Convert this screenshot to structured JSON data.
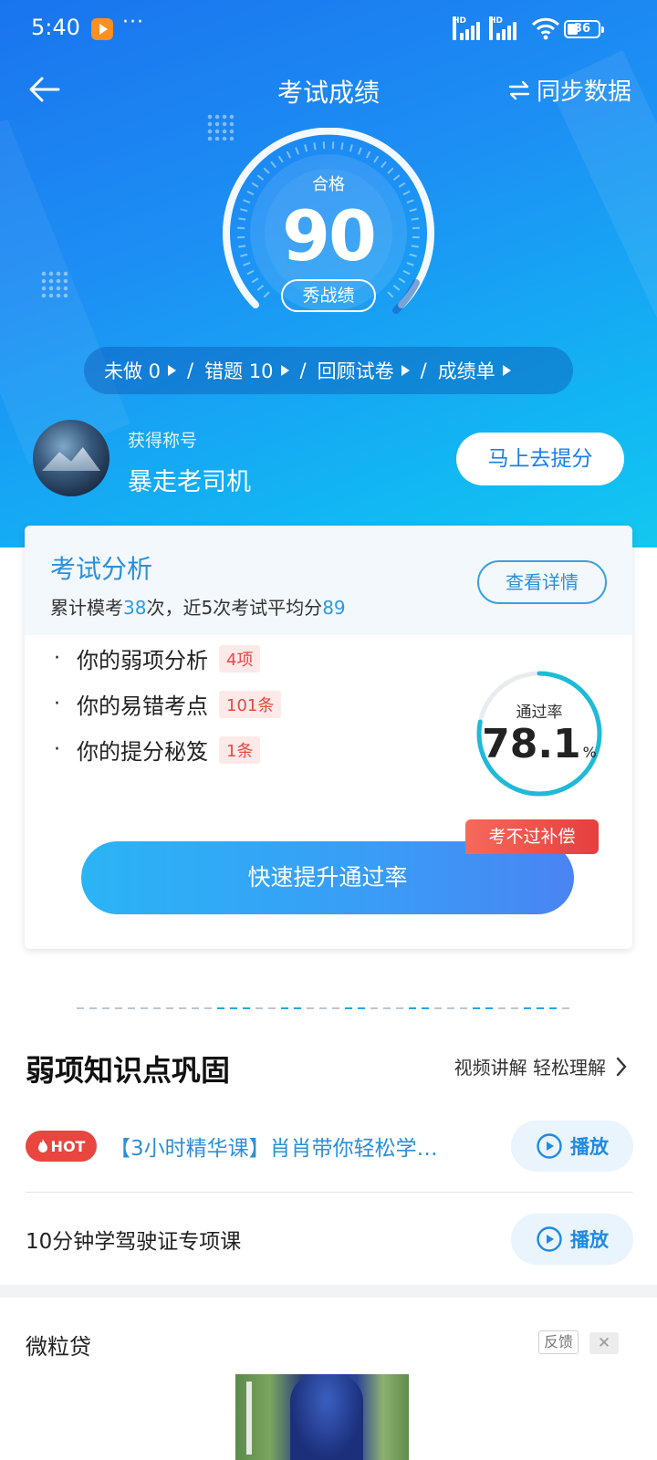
{
  "status_bar": {
    "time": "5:40",
    "more": "···",
    "signal_labels": [
      "HD",
      "HD"
    ],
    "battery": "36"
  },
  "nav": {
    "title": "考试成绩",
    "sync_label": "同步数据"
  },
  "score": {
    "label": "合格",
    "value": "90",
    "show_button": "秀战绩"
  },
  "stats": {
    "undone": "未做 0",
    "wrong": "错题  10",
    "review": "回顾试卷",
    "report": "成绩单",
    "separator": "/"
  },
  "profile": {
    "title_label": "获得称号",
    "nickname": "暴走老司机",
    "improve_button": "马上去提分"
  },
  "analysis": {
    "title": "考试分析",
    "summary_prefix": "累计模考",
    "exam_count": "38",
    "summary_mid": "次，近5次考试平均分",
    "avg_score": "89",
    "detail_button": "查看详情",
    "items": [
      {
        "label": "你的弱项分析",
        "tag": "4项"
      },
      {
        "label": "你的易错考点",
        "tag": "101条"
      },
      {
        "label": "你的提分秘笈",
        "tag": "1条"
      }
    ],
    "pass_rate_label": "通过率",
    "pass_rate": "78.1",
    "pass_rate_unit": "%",
    "pass_rate_fraction": 0.781,
    "compensation_tag": "考不过补偿",
    "boost_button": "快速提升通过率"
  },
  "weak_section": {
    "title": "弱项知识点巩固",
    "subtitle": "视频讲解 轻松理解",
    "courses": [
      {
        "hot_badge": "HOT",
        "title": "【3小时精华课】肖肖带你轻松学…",
        "play": "播放"
      },
      {
        "title": "10分钟学驾驶证专项课",
        "play": "播放"
      }
    ]
  },
  "ad": {
    "name": "微粒贷",
    "feedback": "反馈",
    "close": "✕"
  },
  "colors": {
    "accent": "#2b8fd9",
    "hero_start": "#1a74ee",
    "hero_end": "#13c8f0",
    "tag_red": "#e24a45"
  }
}
